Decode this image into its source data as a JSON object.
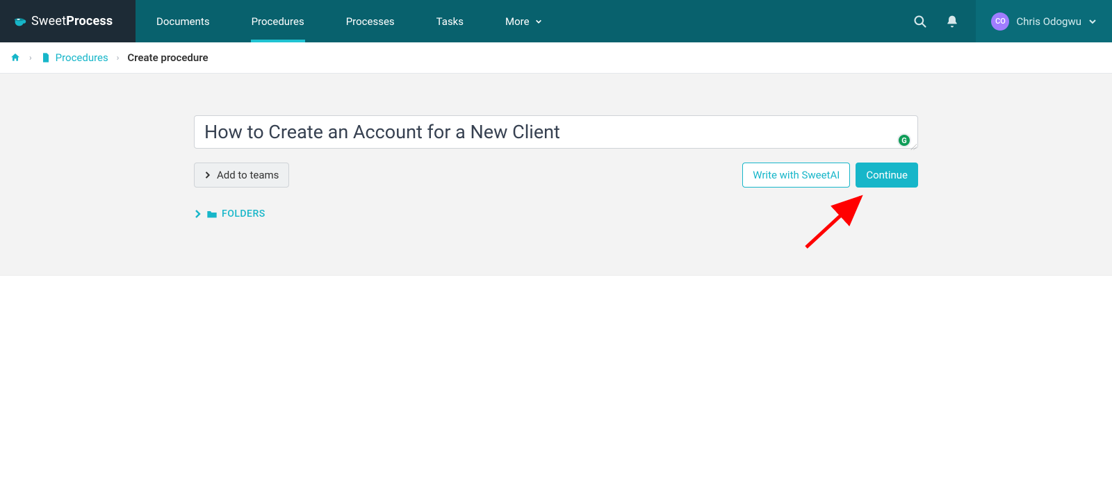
{
  "brand": {
    "name_prefix": "Sweet",
    "name_suffix": "Process"
  },
  "nav": {
    "items": [
      {
        "label": "Documents",
        "active": false
      },
      {
        "label": "Procedures",
        "active": true
      },
      {
        "label": "Processes",
        "active": false
      },
      {
        "label": "Tasks",
        "active": false
      },
      {
        "label": "More",
        "active": false,
        "dropdown": true
      }
    ]
  },
  "user": {
    "initials": "CO",
    "name": "Chris Odogwu"
  },
  "breadcrumb": {
    "home_aria": "Home",
    "procedures_label": "Procedures",
    "current_label": "Create procedure"
  },
  "form": {
    "title_value": "How to Create an Account for a New Client",
    "add_to_teams_label": "Add to teams",
    "write_ai_label": "Write with SweetAI",
    "continue_label": "Continue",
    "folders_label": "FOLDERS",
    "grammarly_initial": "G"
  },
  "colors": {
    "teal": "#17b6c9",
    "header_bg": "#08616d",
    "logo_bg": "#1d2b36",
    "avatar_bg": "#a07dff"
  }
}
